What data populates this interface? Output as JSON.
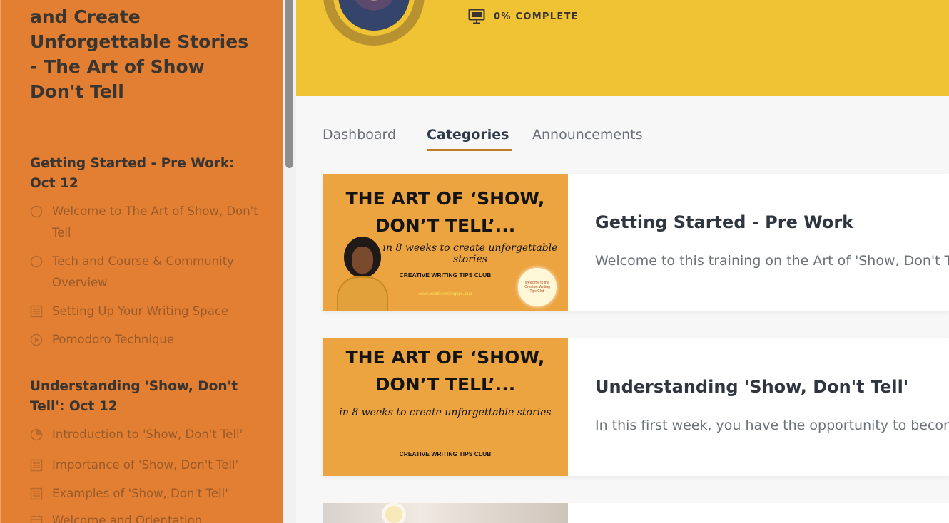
{
  "sidebar": {
    "course_title": "and Create Unforgettable Stories - The Art of Show Don't Tell",
    "sections": [
      {
        "title": "Getting Started - Pre Work: Oct 12",
        "lessons": [
          {
            "label": "Welcome to The Art of Show, Don't Tell",
            "icon": "progress-circle-empty-icon"
          },
          {
            "label": "Tech and Course & Community Overview",
            "icon": "progress-circle-empty-icon"
          },
          {
            "label": "Setting Up Your Writing Space",
            "icon": "text-document-icon"
          },
          {
            "label": "Pomodoro Technique",
            "icon": "play-circle-icon"
          }
        ]
      },
      {
        "title": "Understanding 'Show, Don't Tell': Oct 12",
        "lessons": [
          {
            "label": "Introduction to 'Show, Don't Tell'",
            "icon": "progress-circle-partial-icon"
          },
          {
            "label": "Importance of 'Show, Don't Tell'",
            "icon": "text-document-icon"
          },
          {
            "label": "Examples of 'Show, Don't Tell'",
            "icon": "text-document-icon"
          },
          {
            "label": "Welcome and Orientation",
            "icon": "calendar-icon"
          }
        ]
      }
    ]
  },
  "header": {
    "progress_label": "0% COMPLETE",
    "progress_percent": 0
  },
  "tabs": [
    {
      "label": "Dashboard",
      "active": false
    },
    {
      "label": "Categories",
      "active": true
    },
    {
      "label": "Announcements",
      "active": false
    }
  ],
  "categories": [
    {
      "title": "Getting Started - Pre Work",
      "description": "Welcome to this training on the Art of 'Show, Don't Te",
      "thumb_line1": "THE ART OF ‘SHOW,",
      "thumb_line2": "DON’T TELL’...",
      "thumb_subtitle": "in 8 weeks to create unforgettable stories",
      "thumb_club": "CREATIVE WRITING TIPS CLUB",
      "thumb_url": "www.creativewritingtips.club",
      "thumb_badge": "welcome to the Creative Writing Tips Club"
    },
    {
      "title": "Understanding 'Show, Don't Tell'",
      "description": "In this first week, you have the opportunity to become",
      "thumb_line1": "THE ART OF ‘SHOW,",
      "thumb_line2": "DON’T TELL’...",
      "thumb_subtitle": "in 8 weeks to create unforgettable stories",
      "thumb_club": "CREATIVE WRITING TIPS CLUB"
    }
  ],
  "colors": {
    "sidebar_bg": "#e27f32",
    "hero_bg": "#f0c335",
    "thumb_bg": "#eba43f",
    "tab_active_underline": "#c27a2a"
  }
}
